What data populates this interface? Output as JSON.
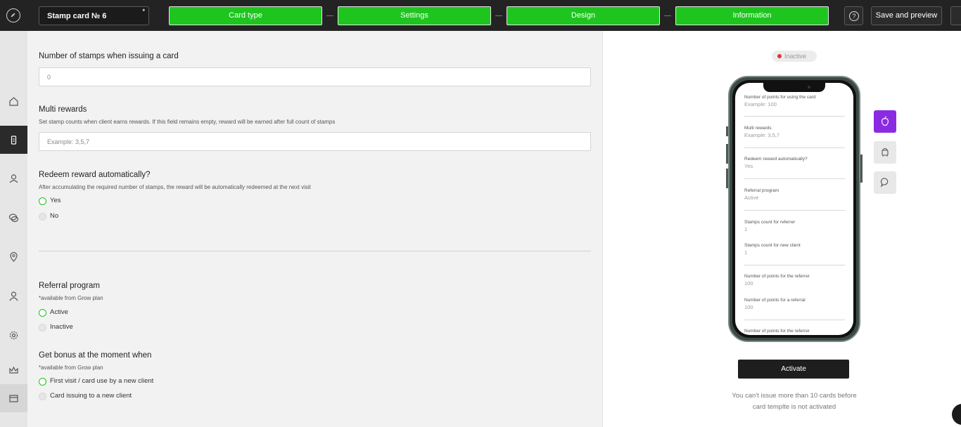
{
  "header": {
    "card_name": "Stamp card № 6",
    "card_name_mark": "*",
    "steps": [
      "Card type",
      "Settings",
      "Design",
      "Information"
    ],
    "help_label": "?",
    "save_label": "Save and preview",
    "accent_color": "#1ec51e"
  },
  "sidebar": {
    "items": [
      "home-icon",
      "card-icon",
      "clients-icon",
      "chat-icon",
      "location-icon",
      "user-icon",
      "gear-icon",
      "crown-icon",
      "store-icon"
    ]
  },
  "form": {
    "stamps_issue": {
      "label": "Number of stamps when issuing a card",
      "value": "0"
    },
    "multi_rewards": {
      "label": "Multi rewards",
      "hint": "Set stamp counts when client earns rewards. If this field remains empty, reward will be earned after full count of stamps",
      "placeholder": "Example: 3,5,7"
    },
    "redeem_auto": {
      "label": "Redeem reward automatically?",
      "hint": "After accumulating the required number of stamps, the reward will be automatically redeemed at the next visit",
      "options": [
        "Yes",
        "No"
      ],
      "selected": "Yes"
    },
    "referral": {
      "label": "Referral program",
      "hint": "*available from Grow plan",
      "options": [
        "Active",
        "Inactive"
      ],
      "selected": "Active"
    },
    "bonus_moment": {
      "label": "Get bonus at the moment when",
      "hint": "*available from Grow plan",
      "options": [
        "First visit / card use by a new client",
        "Card issuing to a new client"
      ],
      "selected": "First visit / card use by a new client"
    }
  },
  "preview": {
    "status": "Inactive",
    "status_color": "#e23333",
    "os_accent": "#8a2be2",
    "phone_fields": [
      {
        "label": "Number of points for using the card",
        "value": "Example: 100"
      },
      {
        "label": "Multi rewards",
        "value": "Example: 3,5,7"
      },
      {
        "label": "Redeem reward automatically?",
        "value": "Yes"
      },
      {
        "label": "Referral program",
        "value": "Active"
      },
      {
        "label": "Stamps count for referrer",
        "value": "1"
      },
      {
        "label": "Stamps count for new client",
        "value": "1"
      },
      {
        "label": "Number of points for the referrer",
        "value": "100"
      },
      {
        "label": "Number of points for a referral",
        "value": "100"
      },
      {
        "label": "Number of points for the referrer",
        "value": ""
      }
    ],
    "activate_label": "Activate",
    "note_line1": "You can't issue more than 10 cards before",
    "note_line2": "card templte is not activated"
  }
}
